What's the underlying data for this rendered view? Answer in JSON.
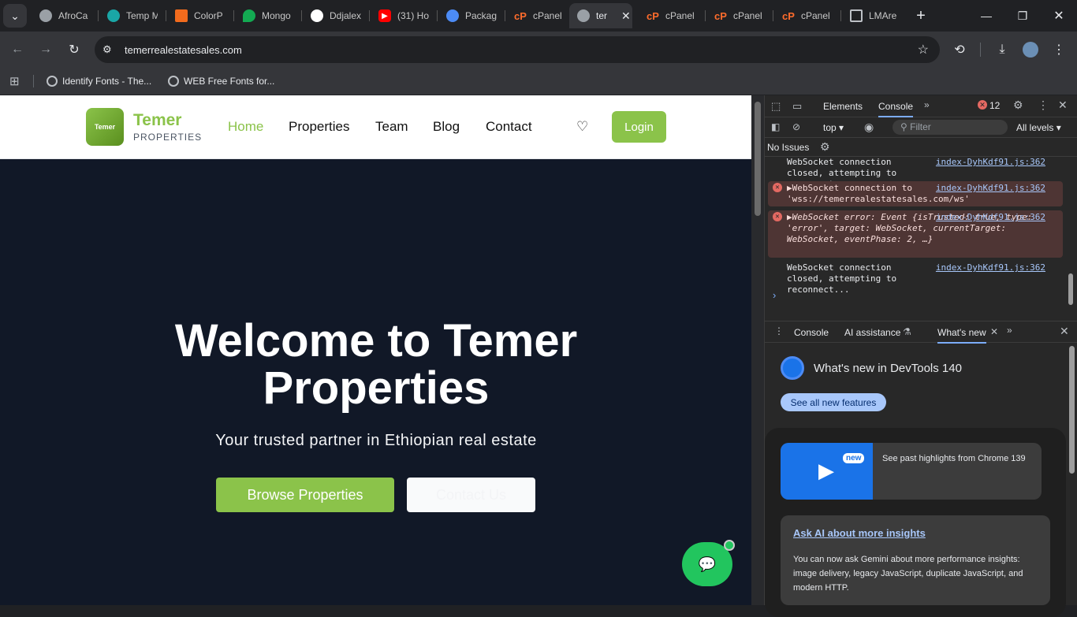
{
  "browser": {
    "tabs": [
      {
        "title": "AfroCa",
        "icon": "globe-icon"
      },
      {
        "title": "Temp M",
        "icon": "site-icon"
      },
      {
        "title": "ColorP",
        "icon": "colorpicker-icon"
      },
      {
        "title": "Mongo",
        "icon": "mongodb-icon"
      },
      {
        "title": "Ddjalex",
        "icon": "github-icon"
      },
      {
        "title": "(31) Ho",
        "icon": "youtube-icon"
      },
      {
        "title": "Packag",
        "icon": "globe-icon"
      },
      {
        "title": "cPanel",
        "icon": "cpanel-icon"
      },
      {
        "title": "ter",
        "icon": "globe-icon"
      },
      {
        "title": "cPanel",
        "icon": "cpanel-icon"
      },
      {
        "title": "cPanel",
        "icon": "cpanel-icon"
      },
      {
        "title": "cPanel",
        "icon": "cpanel-icon"
      },
      {
        "title": "LMAre",
        "icon": "table-icon"
      }
    ],
    "url": "temerrealestatesales.com",
    "bookmarks": [
      {
        "label": "Identify Fonts - The..."
      },
      {
        "label": "WEB Free Fonts for..."
      }
    ]
  },
  "site": {
    "brand": "Temer",
    "brand_sub": "PROPERTIES",
    "logo_text": "Temer",
    "nav": [
      "Home",
      "Properties",
      "Team",
      "Blog",
      "Contact"
    ],
    "login": "Login",
    "hero_title_1": "Welcome to Temer",
    "hero_title_2": "Properties",
    "hero_sub": "Your trusted partner in Ethiopian real estate",
    "browse_btn": "Browse Properties",
    "contact_btn": "Contact Us",
    "accent": "#8bc34a"
  },
  "devtools": {
    "tabs": [
      "Elements",
      "Console"
    ],
    "error_count": "12",
    "context": "top",
    "filter_placeholder": "Filter",
    "levels": "All levels",
    "issues": "No Issues",
    "logs": [
      {
        "text": "WebSocket connection closed, attempting to reconnect...",
        "src": "index-DyhKdf91.js:362"
      },
      {
        "text": "▶WebSocket connection to 'wss://temerrealestatesales.com/ws' failed:",
        "src": "index-DyhKdf91.js:362"
      },
      {
        "text": "▶WebSocket error: Event {isTrusted: true, type: 'error', target: WebSocket, currentTarget: WebSocket, eventPhase: 2, …}",
        "src": "index-DyhKdf91.js:362"
      },
      {
        "text": "WebSocket connection closed, attempting to reconnect...",
        "src": "index-DyhKdf91.js:362"
      }
    ],
    "drawer_tabs": [
      "Console",
      "AI assistance",
      "What's new"
    ],
    "whats_new_title": "What's new in DevTools 140",
    "see_all": "See all new features",
    "card1_badge": "new",
    "card1_text": "See past highlights from Chrome 139",
    "card2_title": "Ask AI about more insights",
    "card2_text": "You can now ask Gemini about more performance insights: image delivery, legacy JavaScript, duplicate JavaScript, and modern HTTP."
  }
}
